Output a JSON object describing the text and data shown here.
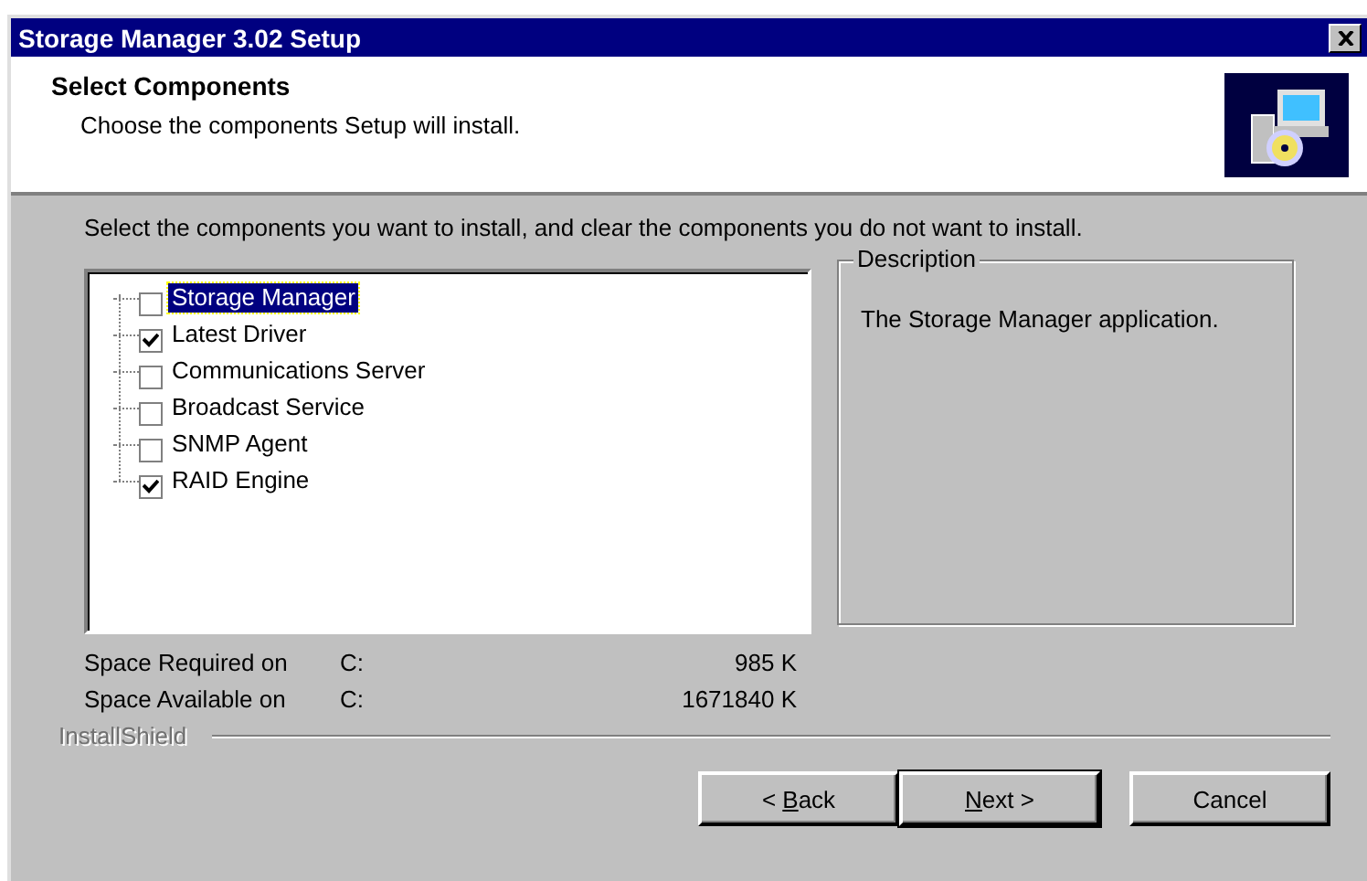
{
  "window": {
    "title": "Storage Manager 3.02 Setup"
  },
  "header": {
    "title": "Select Components",
    "subtitle": "Choose the components Setup will install."
  },
  "instructions": "Select the components you want to install, and clear the components you do not want to install.",
  "components": [
    {
      "label": "Storage Manager",
      "checked": false,
      "selected": true
    },
    {
      "label": "Latest Driver",
      "checked": true,
      "selected": false
    },
    {
      "label": "Communications Server",
      "checked": false,
      "selected": false
    },
    {
      "label": "Broadcast Service",
      "checked": false,
      "selected": false
    },
    {
      "label": "SNMP Agent",
      "checked": false,
      "selected": false
    },
    {
      "label": "RAID Engine",
      "checked": true,
      "selected": false
    }
  ],
  "description": {
    "title": "Description",
    "text": "The Storage Manager application."
  },
  "space": [
    {
      "label": "Space Required on",
      "drive": "C:",
      "value": "985 K"
    },
    {
      "label": "Space Available on",
      "drive": "C:",
      "value": "1671840 K"
    }
  ],
  "brand": "InstallShield",
  "buttons": [
    {
      "label": {
        "before": "< ",
        "key": "B",
        "after": "ack"
      },
      "default": false
    },
    {
      "label": {
        "key": "N",
        "after": "ext >"
      },
      "default": true
    },
    {
      "label": {
        "before": "Cancel"
      },
      "default": false
    }
  ]
}
